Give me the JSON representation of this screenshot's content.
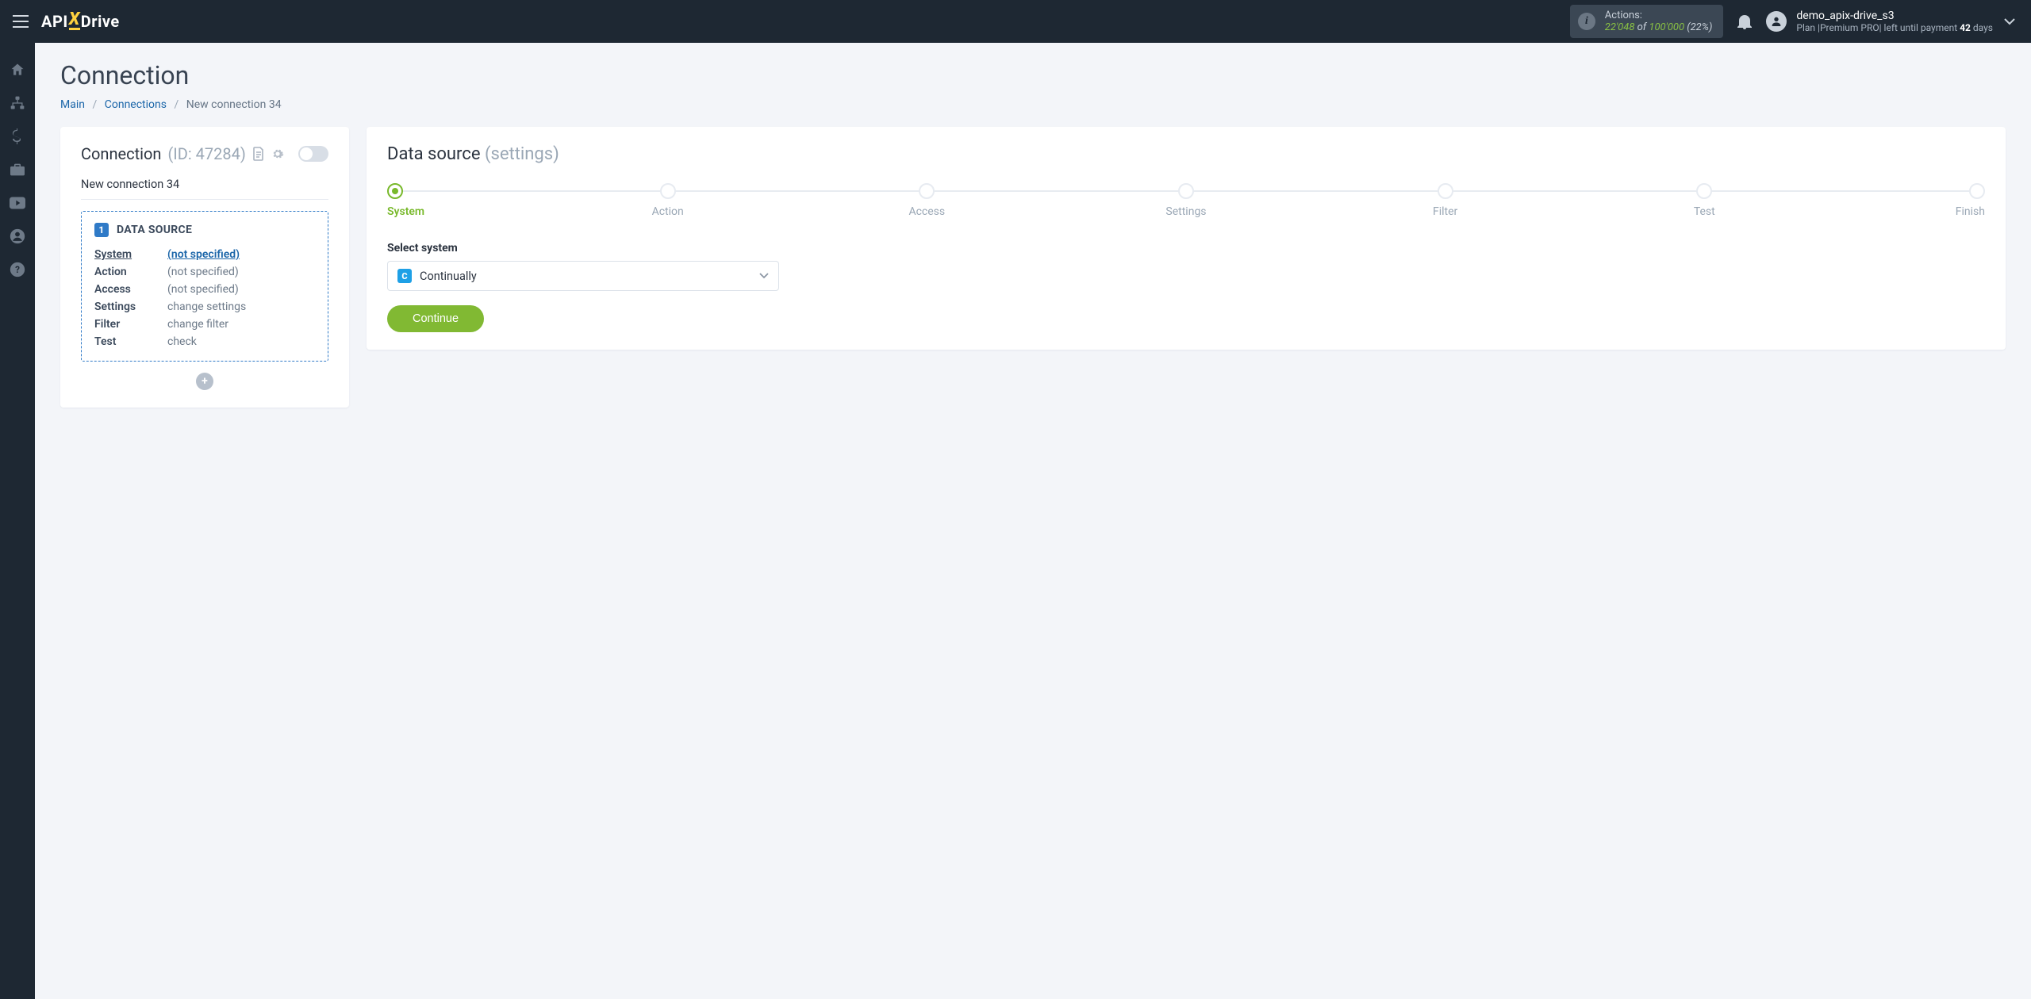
{
  "header": {
    "logo": {
      "part1": "API",
      "x": "X",
      "part2": "Drive"
    },
    "actions": {
      "label": "Actions:",
      "count": "22'048",
      "of": " of ",
      "limit": "100'000",
      "pct": " (22%)"
    },
    "user": {
      "name": "demo_apix-drive_s3",
      "plan_prefix": "Plan |",
      "plan_name": "Premium PRO",
      "plan_mid": "| left until payment ",
      "days_num": "42",
      "days_suffix": " days"
    }
  },
  "page": {
    "title": "Connection",
    "breadcrumb": {
      "main": "Main",
      "connections": "Connections",
      "current": "New connection 34"
    }
  },
  "left": {
    "head_label": "Connection ",
    "head_id": "(ID: 47284)",
    "name": "New connection 34",
    "ds_title": "DATA SOURCE",
    "rows": [
      {
        "k": "System",
        "v": "(not specified)",
        "ku": true,
        "link": true
      },
      {
        "k": "Action",
        "v": "(not specified)"
      },
      {
        "k": "Access",
        "v": "(not specified)"
      },
      {
        "k": "Settings",
        "v": "change settings"
      },
      {
        "k": "Filter",
        "v": "change filter"
      },
      {
        "k": "Test",
        "v": "check"
      }
    ]
  },
  "right": {
    "heading": "Data source ",
    "heading_sub": "(settings)",
    "steps": [
      "System",
      "Action",
      "Access",
      "Settings",
      "Filter",
      "Test",
      "Finish"
    ],
    "active_step": 0,
    "field_label": "Select system",
    "selected": "Continually",
    "selected_initial": "C",
    "continue": "Continue"
  }
}
